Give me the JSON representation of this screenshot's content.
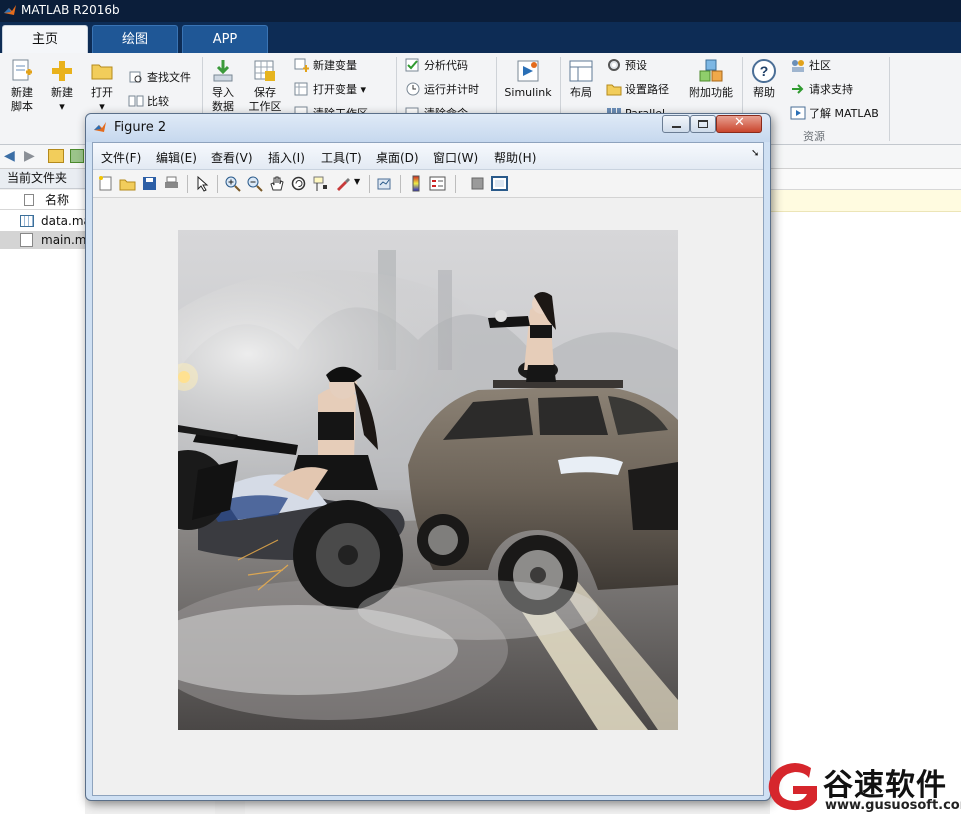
{
  "app": {
    "title": "MATLAB R2016b"
  },
  "tabs": [
    {
      "label": "主页",
      "active": true
    },
    {
      "label": "绘图",
      "active": false
    },
    {
      "label": "APP",
      "active": false
    }
  ],
  "ribbon": {
    "file": {
      "new_script": [
        "新建",
        "脚本"
      ],
      "new": "新建",
      "open": "打开",
      "find_files": "查找文件",
      "compare": "比较"
    },
    "variable": {
      "import": [
        "导入",
        "数据"
      ],
      "save_workspace": [
        "保存",
        "工作区"
      ],
      "new_variable": "新建变量",
      "open_variable": "打开变量",
      "clear_workspace": "清除工作区"
    },
    "code": {
      "analyze": "分析代码",
      "run_time": "运行并计时",
      "clear_commands": "清除命令"
    },
    "simulink": {
      "label": "Simulink"
    },
    "environment": {
      "layout": "布局",
      "preferences": "预设",
      "set_path": "设置路径",
      "parallel": "Parallel",
      "addons": "附加功能"
    },
    "resources": {
      "help": "帮助",
      "community": "社区",
      "request_support": "请求支持",
      "learn_matlab": "了解 MATLAB",
      "group_label": "资源"
    }
  },
  "left_panel": {
    "current_folder_title": "当前文件夹",
    "column_name": "名称",
    "files": [
      {
        "name": "data.mat",
        "icon": "mat-file-icon"
      },
      {
        "name": "main.m",
        "icon": "m-file-icon",
        "selected": true
      }
    ]
  },
  "figure": {
    "title": "Figure 2",
    "menu": [
      "文件(F)",
      "编辑(E)",
      "查看(V)",
      "插入(I)",
      "工具(T)",
      "桌面(D)",
      "窗口(W)",
      "帮助(H)"
    ],
    "toolbar_icons": [
      "new-figure-icon",
      "open-file-icon",
      "save-icon",
      "print-icon",
      "pointer-icon",
      "zoom-in-icon",
      "zoom-out-icon",
      "pan-icon",
      "rotate-icon",
      "data-cursor-icon",
      "brush-icon",
      "link-plot-icon",
      "colorbar-icon",
      "legend-icon",
      "hide-plot-tools-icon",
      "show-plot-tools-icon"
    ],
    "image_description": "Two women in black outfits with guns; one on a motorcycle, one standing on an SUV, on a smoky road"
  },
  "watermark": {
    "brand": "谷速软件",
    "url": "www.gusuosoft.com"
  },
  "colors": {
    "titlebar": "#0b1e3a",
    "tabbar": "#0d2c55",
    "active_tab": "#f4f6f9",
    "ribbon": "#f3f4f6",
    "figure_frame": "#cfe0f3",
    "watermark_red": "#d6262c"
  }
}
